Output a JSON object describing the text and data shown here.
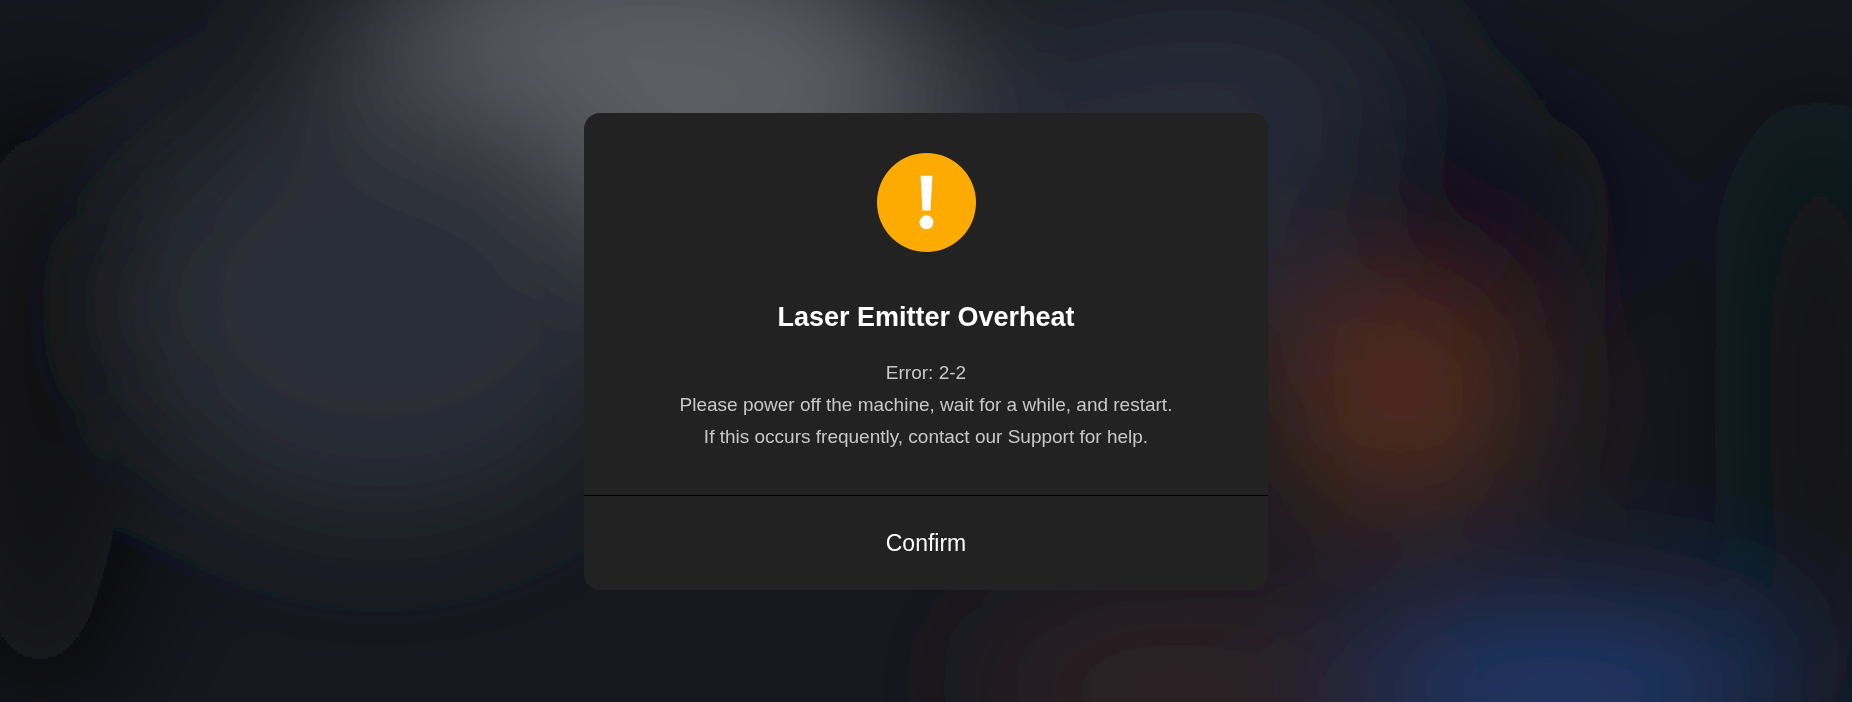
{
  "dialog": {
    "title": "Laser Emitter Overheat",
    "message_lines": [
      "Error: 2-2",
      "Please power off the machine, wait for a while, and restart.",
      "If this occurs frequently, contact our Support for help."
    ],
    "button": "Confirm"
  }
}
